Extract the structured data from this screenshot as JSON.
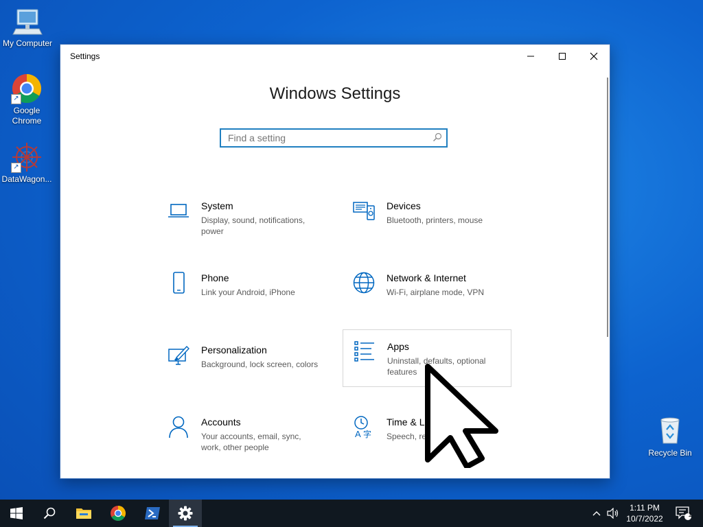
{
  "desktop": {
    "icons": [
      {
        "label": "My Computer",
        "icon": "computer-icon"
      },
      {
        "label": "Google Chrome",
        "icon": "chrome-icon"
      },
      {
        "label": "DataWagon...",
        "icon": "datawagon-icon"
      },
      {
        "label": "Recycle Bin",
        "icon": "recycle-bin-icon"
      }
    ]
  },
  "window": {
    "title": "Settings",
    "heading": "Windows Settings",
    "search": {
      "placeholder": "Find a setting"
    },
    "tiles": [
      {
        "name": "System",
        "desc": "Display, sound, notifications, power",
        "icon": "laptop-icon"
      },
      {
        "name": "Devices",
        "desc": "Bluetooth, printers, mouse",
        "icon": "devices-icon"
      },
      {
        "name": "Phone",
        "desc": "Link your Android, iPhone",
        "icon": "phone-icon"
      },
      {
        "name": "Network & Internet",
        "desc": "Wi-Fi, airplane mode, VPN",
        "icon": "globe-icon"
      },
      {
        "name": "Personalization",
        "desc": "Background, lock screen, colors",
        "icon": "paint-icon"
      },
      {
        "name": "Apps",
        "desc": "Uninstall, defaults, optional features",
        "icon": "apps-list-icon"
      },
      {
        "name": "Accounts",
        "desc": "Your accounts, email, sync, work, other people",
        "icon": "person-icon"
      },
      {
        "name": "Time & La",
        "desc": "Speech, reg",
        "icon": "time-language-icon"
      }
    ]
  },
  "taskbar": {
    "apps": [
      "start-icon",
      "search-icon",
      "file-explorer-icon",
      "chrome-icon",
      "powershell-icon",
      "settings-gear-icon"
    ],
    "clock": {
      "time": "1:11 PM",
      "date": "10/7/2022"
    },
    "notification_count": "1"
  },
  "colors": {
    "accent": "#0067c0",
    "taskbar": "#101820",
    "desktop": "#0d63cf"
  }
}
